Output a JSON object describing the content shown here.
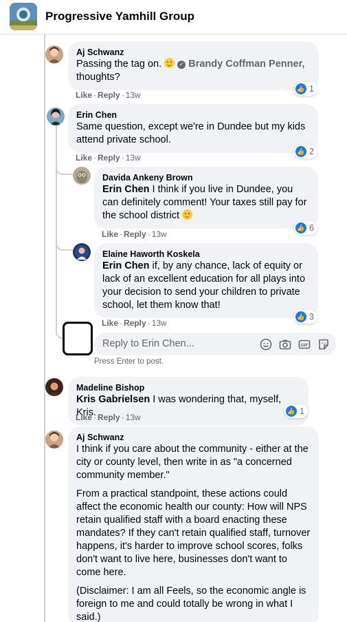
{
  "group": {
    "name": "Progressive Yamhill Group"
  },
  "comments": [
    {
      "author": "Aj Schwanz",
      "text_before": "Passing the tag on. ",
      "tag_name": "Brandy Coffman Penner,",
      "text_after": "thoughts?",
      "like": "Like",
      "reply": "Reply",
      "time": "13w",
      "reactions": "1"
    },
    {
      "author": "Erin Chen",
      "text": "Same question, except we're in Dundee but my kids attend private school.",
      "like": "Like",
      "reply": "Reply",
      "time": "13w",
      "reactions": "2"
    },
    {
      "author": "Davida Ankeny Brown",
      "mention": "Erin Chen",
      "text": " I think if you live in Dundee, you can definitely comment! Your taxes still pay for the school district ",
      "like": "Like",
      "reply": "Reply",
      "time": "13w",
      "reactions": "6"
    },
    {
      "author": "Elaine Haworth Koskela",
      "mention": "Erin Chen",
      "text": " if, by any chance, lack of equity or lack of an excellent education for all plays into your decision to send your children to private school, let them know that!",
      "like": "Like",
      "reply": "Reply",
      "time": "13w",
      "reactions": "3"
    },
    {
      "author": "Madeline Bishop",
      "mention": "Kris Gabrielsen",
      "text": " I was wondering that, myself, Kris.",
      "like": "Like",
      "reply": "Reply",
      "time": "13w",
      "reactions": "1"
    },
    {
      "author": "Aj Schwanz",
      "paragraphs": [
        "I think if you care about the community - either at the city or county level, then write in as \"a concerned community member.\"",
        "From a practical standpoint, these actions could affect the economic health our county: How will NPS retain qualified staff with a board enacting these mandates? If they can't retain qualified staff, turnover happens, it's harder to improve school scores, folks don't want to live here, businesses don't want to come here.",
        "(Disclaimer: I am all Feels, so the economic angle is foreign to me and could totally be wrong in what I said.)"
      ]
    }
  ],
  "reply_box": {
    "placeholder": "Reply to Erin Chen...",
    "hint": "Press Enter to post."
  },
  "icons": [
    "emoji-icon",
    "camera-icon",
    "gif-icon",
    "sticker-icon",
    "like-icon"
  ],
  "colors": {
    "like_blue": "#1877f2",
    "bubble_bg": "#f0f2f5",
    "meta_gray": "#65676b"
  }
}
